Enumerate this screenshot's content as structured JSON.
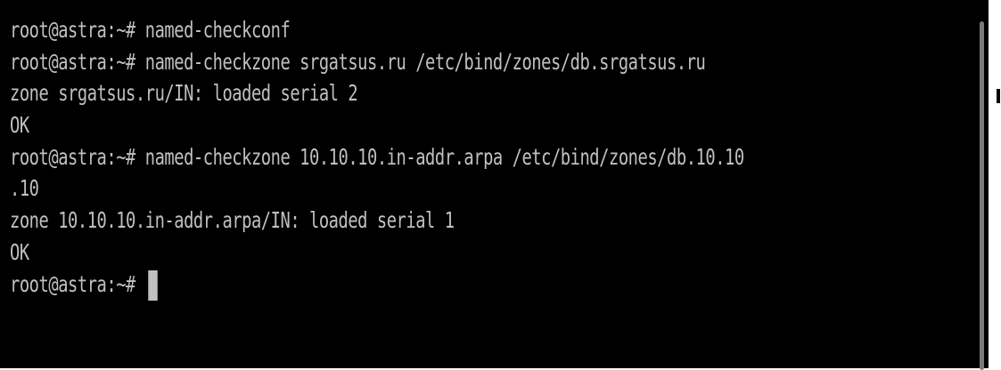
{
  "terminal": {
    "colors": {
      "background": "#000000",
      "foreground": "#c0c0c0",
      "scrollbar": "#7a7a7a"
    },
    "lines": [
      "root@astra:~# named-checkconf",
      "root@astra:~# named-checkzone srgatsus.ru /etc/bind/zones/db.srgatsus.ru",
      "zone srgatsus.ru/IN: loaded serial 2",
      "OK",
      "root@astra:~# named-checkzone 10.10.10.in-addr.arpa /etc/bind/zones/db.10.10",
      ".10",
      "zone 10.10.10.in-addr.arpa/IN: loaded serial 1",
      "OK",
      "root@astra:~# "
    ]
  }
}
